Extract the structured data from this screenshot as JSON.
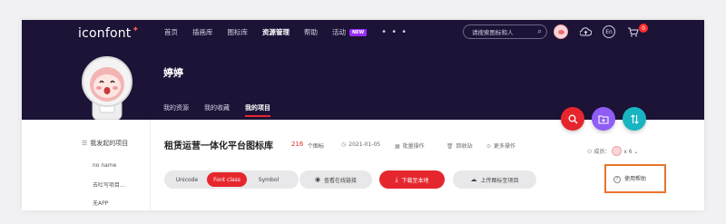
{
  "header": {
    "logo": "iconfont",
    "nav": [
      {
        "label": "首页",
        "active": false
      },
      {
        "label": "插画库",
        "active": false
      },
      {
        "label": "图标库",
        "active": false
      },
      {
        "label": "资源管理",
        "active": true
      },
      {
        "label": "帮助",
        "active": false
      },
      {
        "label": "活动",
        "active": false,
        "badge": "NEW"
      }
    ],
    "more_label": "• • •",
    "search_placeholder": "请搜索图标和人",
    "en_label": "En",
    "cart_count": "0"
  },
  "profile": {
    "name": "婷婷",
    "tabs": [
      {
        "label": "我的资源",
        "active": false
      },
      {
        "label": "我的收藏",
        "active": false
      },
      {
        "label": "我的项目",
        "active": true
      }
    ]
  },
  "sidebar": {
    "heading": "我发起的项目",
    "items": [
      "no name",
      "去吐写项目...",
      "无APP"
    ]
  },
  "project": {
    "title": "租赁运营一体化平台图标库",
    "icon_count": "216",
    "icon_count_label": "个图标",
    "date": "2021-01-05",
    "batch_label": "批量操作",
    "recycle_label": "回收站",
    "more_label": "更多操作",
    "members_label": "成员：",
    "members_count": "x 6"
  },
  "toolbar": {
    "formats": [
      {
        "label": "Unicode",
        "active": false
      },
      {
        "label": "Font class",
        "active": true
      },
      {
        "label": "Symbol",
        "active": false
      }
    ],
    "view_online": "查看在线链接",
    "download": "下载至本地",
    "upload": "上传图标至项目",
    "help": "使用帮助"
  },
  "colors": {
    "header_bg": "#1c1337",
    "accent_red": "#e6262d",
    "purple": "#8f5cf5",
    "teal": "#19b4c2",
    "highlight_box": "#e8742b"
  }
}
